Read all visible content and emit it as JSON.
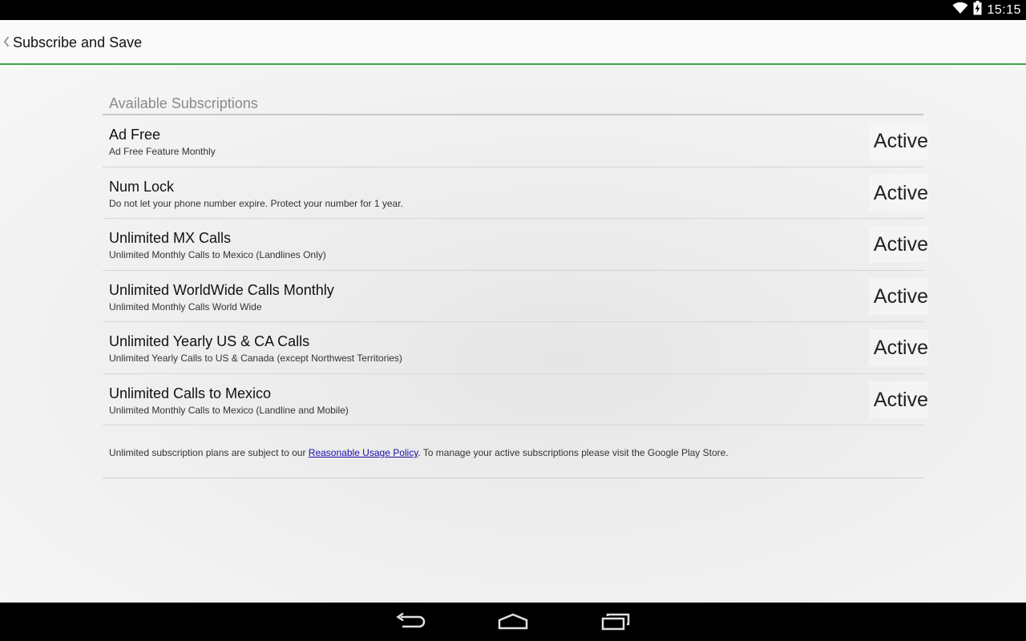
{
  "status_bar": {
    "time": "15:15",
    "icons": [
      "wifi-icon",
      "battery-icon"
    ]
  },
  "action_bar": {
    "title": "Subscribe and Save",
    "back_icon": "chevron-left-icon",
    "accent_color": "#3fa44a"
  },
  "subscriptions": {
    "header": "Available Subscriptions",
    "items": [
      {
        "name": "Ad Free",
        "description": "Ad Free Feature Monthly",
        "status": "Active"
      },
      {
        "name": "Num Lock",
        "description": "Do not let your phone number expire. Protect your number for 1 year.",
        "status": "Active"
      },
      {
        "name": "Unlimited MX Calls",
        "description": "Unlimited Monthly Calls to Mexico (Landlines Only)",
        "status": "Active"
      },
      {
        "name": "Unlimited WorldWide Calls Monthly",
        "description": "Unlimited Monthly Calls World Wide",
        "status": "Active"
      },
      {
        "name": "Unlimited Yearly US & CA Calls",
        "description": "Unlimited Yearly Calls to US & Canada (except Northwest Territories)",
        "status": "Active"
      },
      {
        "name": "Unlimited Calls to Mexico",
        "description": "Unlimited Monthly Calls to Mexico (Landline and Mobile)",
        "status": "Active"
      }
    ]
  },
  "footer": {
    "text_before": "Unlimited subscription plans are subject to our ",
    "link_text": "Reasonable Usage Policy",
    "text_after": ". To manage your active subscriptions please visit the Google Play Store."
  },
  "nav_bar": {
    "icons": [
      "back-icon",
      "home-icon",
      "recents-icon"
    ]
  }
}
